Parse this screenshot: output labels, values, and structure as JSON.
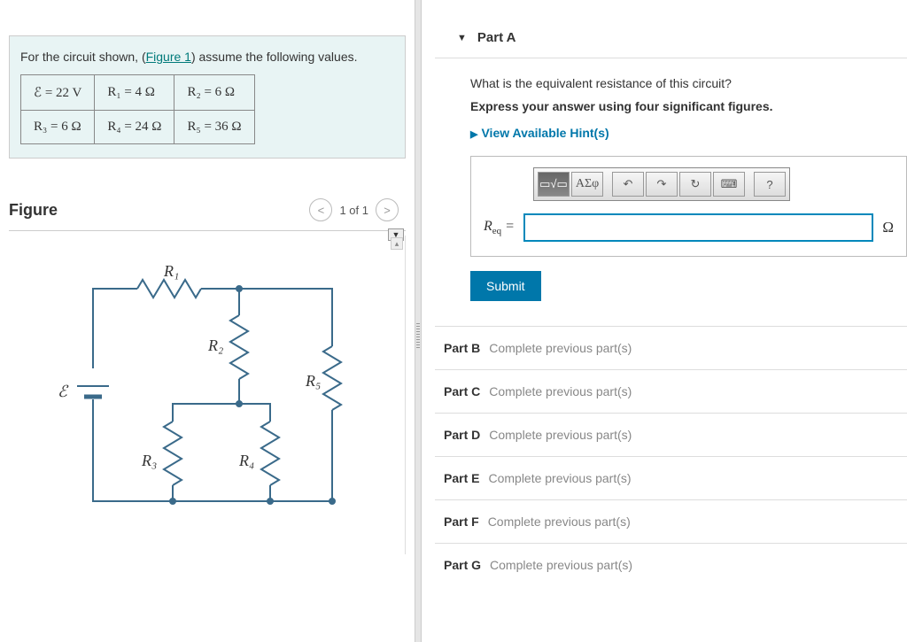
{
  "problem": {
    "intro_prefix": "For the circuit shown, (",
    "figure_link": "Figure 1",
    "intro_suffix": ") assume the following values.",
    "values": {
      "r1c1": "ℰ = 22 V",
      "r1c2": "R₁ = 4 Ω",
      "r1c3": "R₂ = 6 Ω",
      "r2c1": "R₃ = 6 Ω",
      "r2c2": "R₄ = 24 Ω",
      "r2c3": "R₅ = 36 Ω"
    }
  },
  "figure": {
    "title": "Figure",
    "pager": "1 of 1",
    "labels": {
      "R1": "R₁",
      "R2": "R₂",
      "R3": "R₃",
      "R4": "R₄",
      "R5": "R₅",
      "E": "ℰ"
    }
  },
  "partA": {
    "title": "Part A",
    "question": "What is the equivalent resistance of this circuit?",
    "instruction": "Express your answer using four significant figures.",
    "hints": "View Available Hint(s)",
    "toolbar": {
      "templates": "▭√▭",
      "greek": "ΑΣφ",
      "undo": "↶",
      "redo": "↷",
      "reset": "↻",
      "keyboard": "⌨",
      "help": "?"
    },
    "eq_label": "R",
    "eq_sub": "eq",
    "equals": " =",
    "unit": "Ω",
    "submit": "Submit"
  },
  "locked": [
    {
      "label": "Part B",
      "msg": "Complete previous part(s)"
    },
    {
      "label": "Part C",
      "msg": "Complete previous part(s)"
    },
    {
      "label": "Part D",
      "msg": "Complete previous part(s)"
    },
    {
      "label": "Part E",
      "msg": "Complete previous part(s)"
    },
    {
      "label": "Part F",
      "msg": "Complete previous part(s)"
    },
    {
      "label": "Part G",
      "msg": "Complete previous part(s)"
    }
  ]
}
